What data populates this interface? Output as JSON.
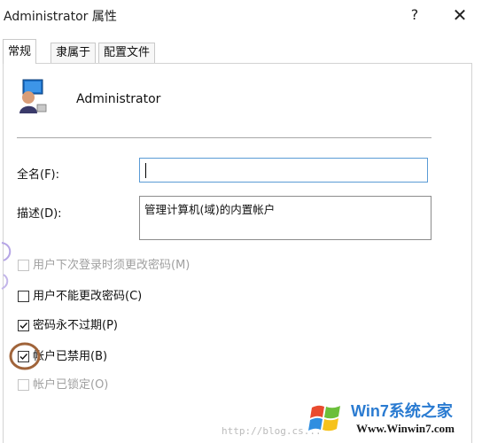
{
  "window": {
    "title": "Administrator 属性",
    "help_glyph": "?",
    "close_glyph": "✕"
  },
  "tabs": [
    {
      "label": "常规",
      "active": true
    },
    {
      "label": "隶属于",
      "active": false
    },
    {
      "label": "配置文件",
      "active": false
    }
  ],
  "user": {
    "icon": "user-account-icon",
    "name": "Administrator"
  },
  "fields": {
    "fullname_label": "全名(F):",
    "fullname_value": "",
    "description_label": "描述(D):",
    "description_value": "管理计算机(域)的内置帐户"
  },
  "options": [
    {
      "label": "用户下次登录时须更改密码(M)",
      "checked": false,
      "enabled": false
    },
    {
      "label": "用户不能更改密码(C)",
      "checked": false,
      "enabled": true
    },
    {
      "label": "密码永不过期(P)",
      "checked": true,
      "enabled": true
    },
    {
      "label": "帐户已禁用(B)",
      "checked": true,
      "enabled": true
    },
    {
      "label": "帐户已锁定(O)",
      "checked": false,
      "enabled": false
    }
  ],
  "watermark": {
    "url_text": "http://blog.cs...",
    "logo_main": "Win7系统之家",
    "logo_sub": "Www.Winwin7.com"
  },
  "colors": {
    "annotation_circle": "#a0643a",
    "input_focus_border": "#5a9bd5",
    "logo_blue": "#2a7bd1"
  }
}
